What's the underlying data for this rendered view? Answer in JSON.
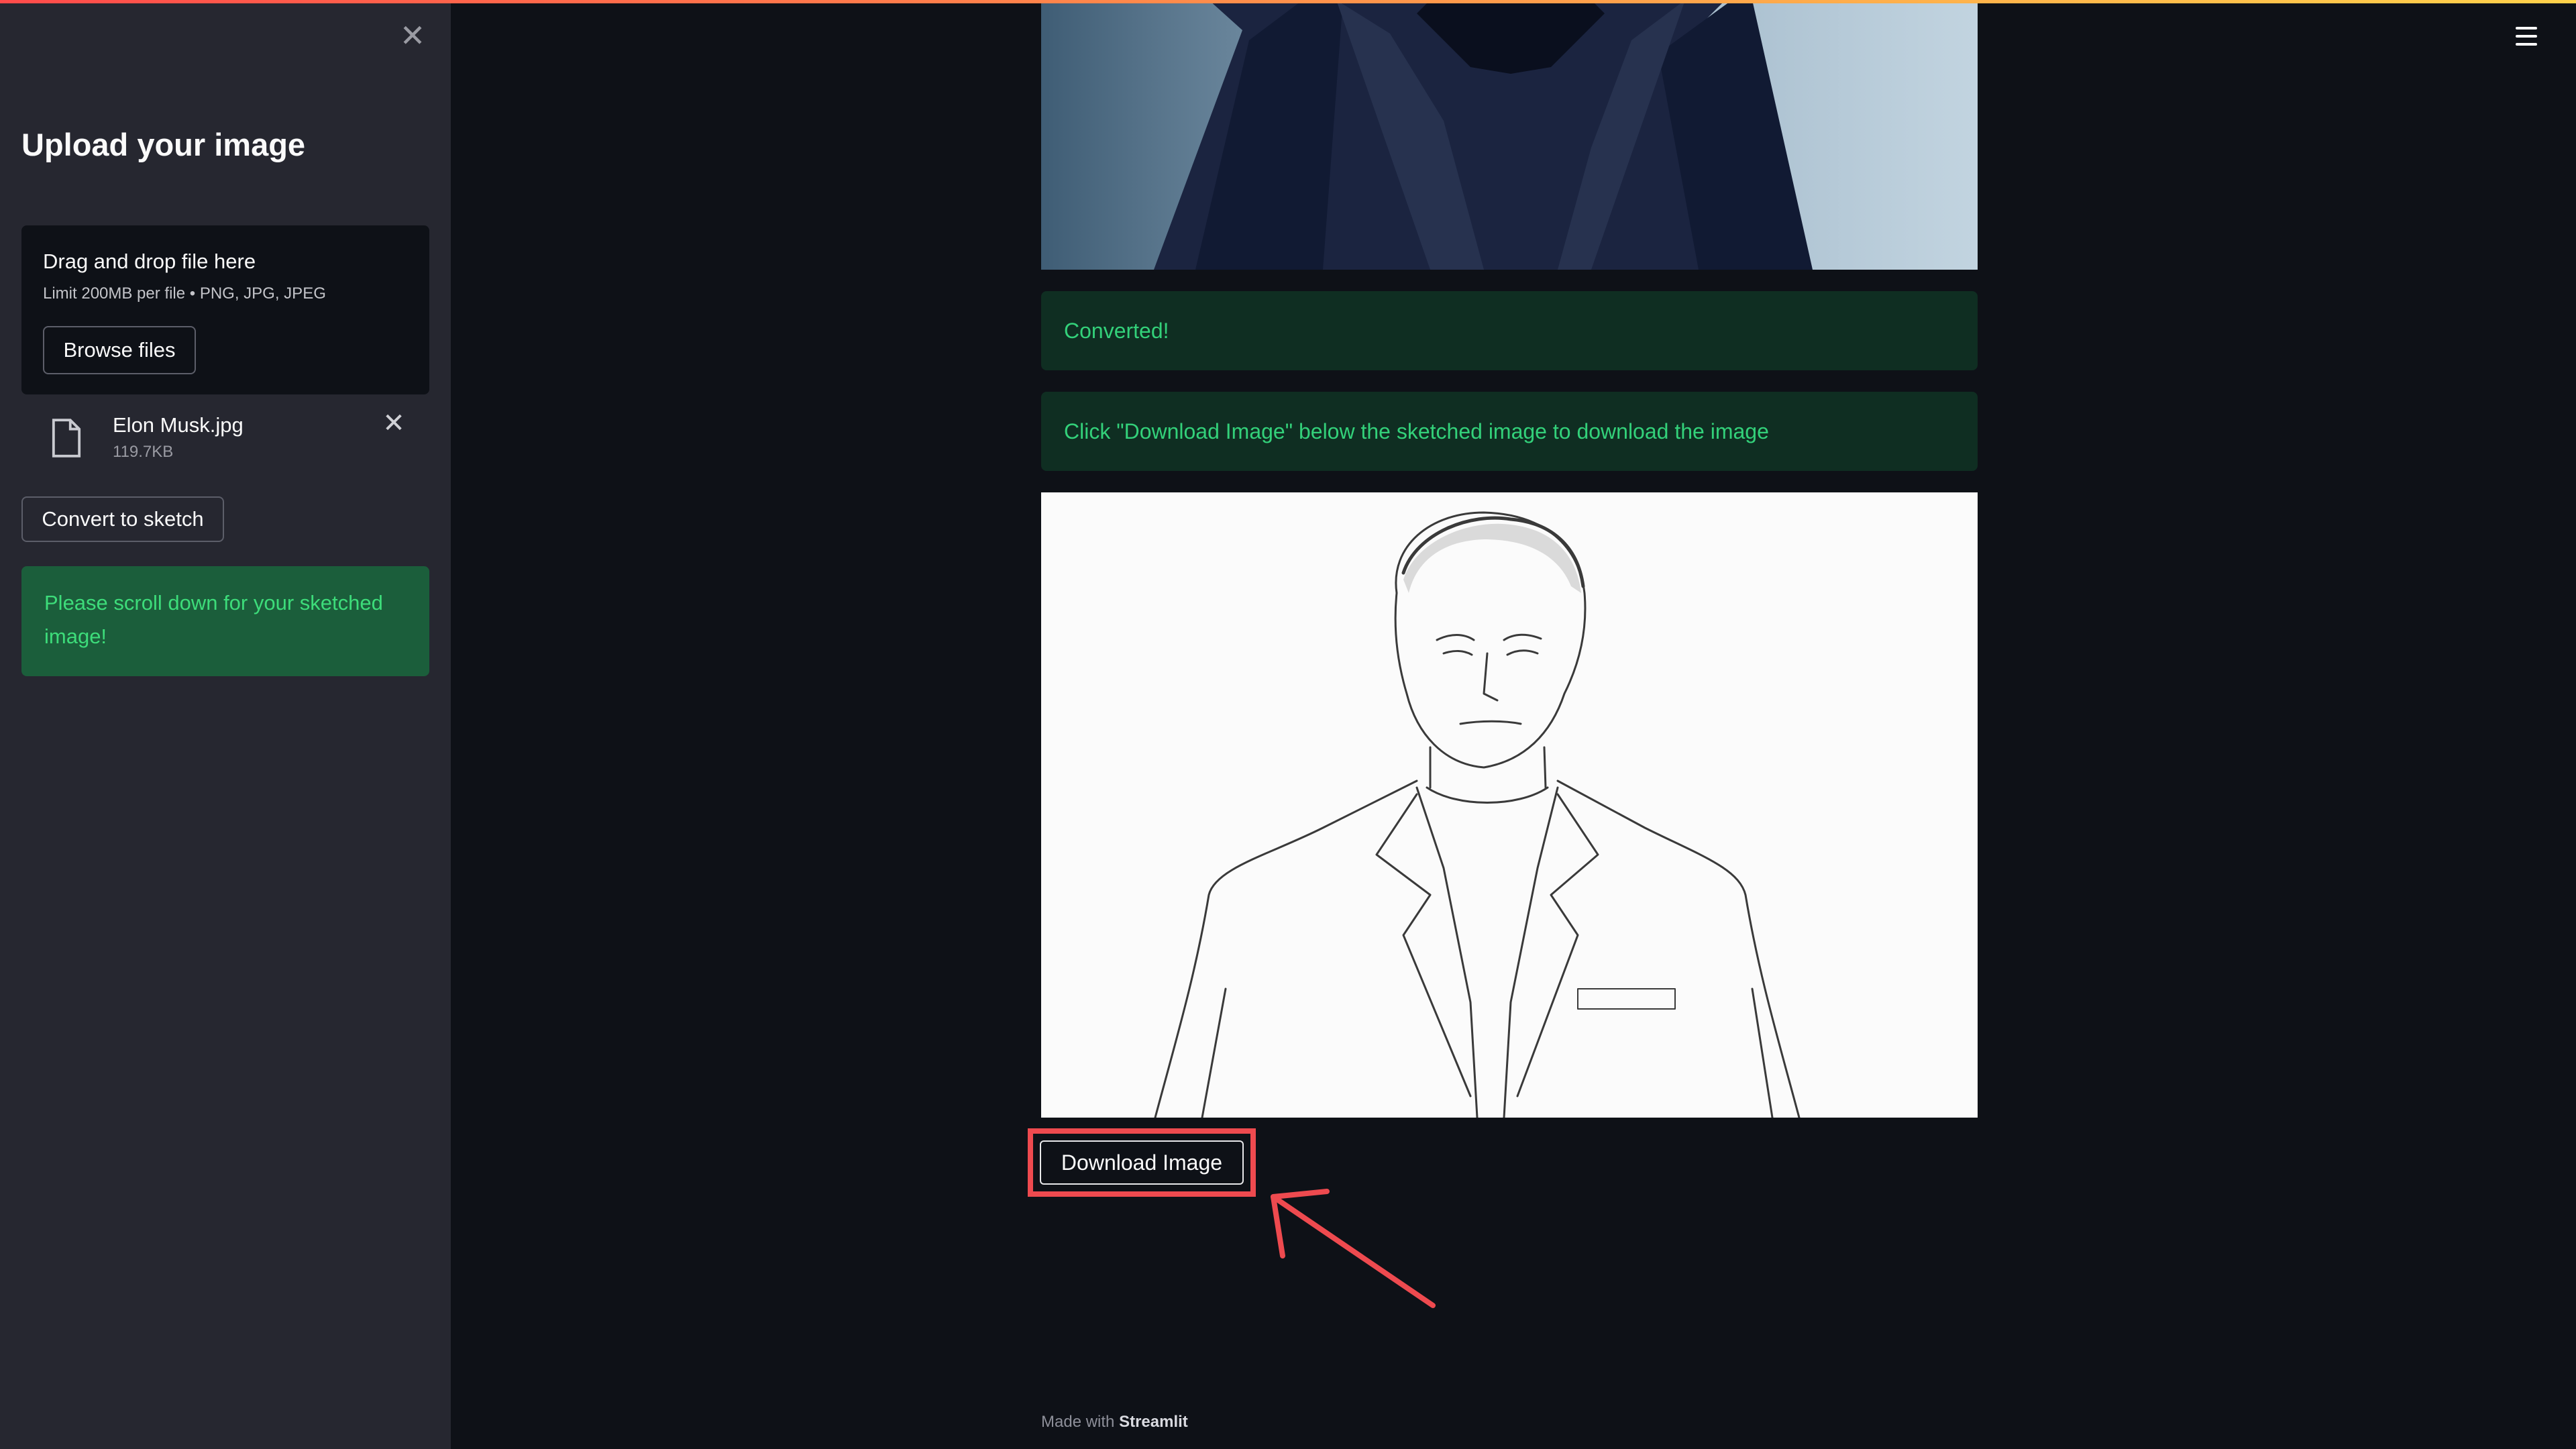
{
  "sidebar": {
    "title": "Upload your image",
    "close_icon": "close-icon",
    "uploader": {
      "drag_text": "Drag and drop file here",
      "limit_text": "Limit 200MB per file • PNG, JPG, JPEG",
      "browse_label": "Browse files"
    },
    "file": {
      "name": "Elon Musk.jpg",
      "size": "119.7KB",
      "icon": "file-icon",
      "remove_icon": "close-icon"
    },
    "convert_label": "Convert to sketch",
    "alert_text": "Please scroll down for your sketched image!"
  },
  "main": {
    "menu_icon": "hamburger-menu-icon",
    "original_image": "photo-of-man-in-suit",
    "converted_message": "Converted!",
    "info_message": "Click \"Download Image\" below the sketched image to download the image",
    "sketch_image": "pencil-sketch-of-man-in-suit",
    "download_label": "Download Image",
    "annotation": "red-arrow-pointing-to-download-button"
  },
  "footer": {
    "prefix": "Made with ",
    "brand": "Streamlit"
  },
  "colors": {
    "background": "#0e1117",
    "sidebar": "#262730",
    "success_text": "#33d17a",
    "success_bg": "#0f2e22",
    "highlight": "#ee4a4f"
  }
}
